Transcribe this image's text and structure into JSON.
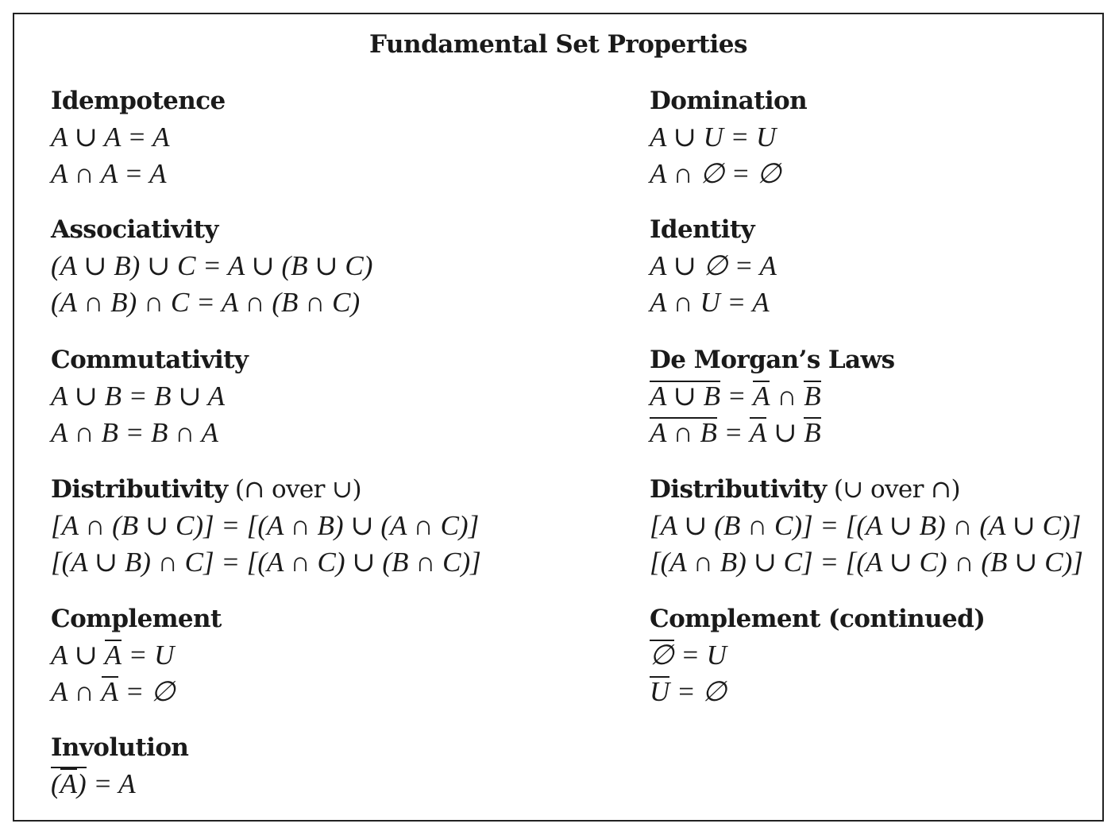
{
  "title": "Fundamental Set Properties",
  "sections": {
    "idempotence": {
      "heading": "Idempotence",
      "eq1": "A ∪ A = A",
      "eq2": "A ∩ A = A"
    },
    "domination": {
      "heading": "Domination",
      "eq1": "A ∪ U = U",
      "eq2": "A ∩ ∅ = ∅"
    },
    "associativity": {
      "heading": "Associativity",
      "eq1": "(A ∪ B) ∪ C = A ∪ (B ∪ C)",
      "eq2": "(A ∩ B) ∩ C = A ∩ (B ∩ C)"
    },
    "identity": {
      "heading": "Identity",
      "eq1": "A ∪ ∅ = A",
      "eq2": "A ∩ U = A"
    },
    "commutativity": {
      "heading": "Commutativity",
      "eq1": "A ∪ B = B ∪ A",
      "eq2": "A ∩ B = B ∩ A"
    },
    "demorgan": {
      "heading": "De Morgan’s Laws",
      "eq1": {
        "lhs": "A ∪ B",
        "eq": " = ",
        "r1": "A",
        "op": " ∩ ",
        "r2": "B"
      },
      "eq2": {
        "lhs": "A ∩ B",
        "eq": " = ",
        "r1": "A",
        "op": " ∪ ",
        "r2": "B"
      }
    },
    "distrib_left": {
      "heading_main": "Distributivity",
      "heading_paren": " (∩ over ∪)",
      "eq1": "[A ∩ (B ∪ C)] = [(A ∩ B) ∪ (A ∩ C)]",
      "eq2": "[(A ∪ B) ∩ C] = [(A ∩ C) ∪ (B ∩ C)]"
    },
    "distrib_right": {
      "heading_main": "Distributivity",
      "heading_paren": " (∪ over ∩)",
      "eq1": "[A ∪ (B ∩ C)] = [(A ∪ B) ∩ (A ∪ C)]",
      "eq2": "[(A ∩ B) ∪ C] = [(A ∪ C) ∩ (B ∪ C)]"
    },
    "complement": {
      "heading": "Complement",
      "eq1": {
        "pre": "A ∪ ",
        "bar": "A",
        "post": " = U"
      },
      "eq2": {
        "pre": "A ∩ ",
        "bar": "A",
        "post": " = ∅"
      }
    },
    "complement_cont": {
      "heading": "Complement (continued)",
      "eq1": {
        "bar": "∅",
        "post": " = U"
      },
      "eq2": {
        "bar": "U",
        "post": " = ∅"
      }
    },
    "involution": {
      "heading": "Involution",
      "eq1": {
        "open": "(",
        "bar": "A",
        "close": ")",
        "post": " = A"
      }
    }
  }
}
